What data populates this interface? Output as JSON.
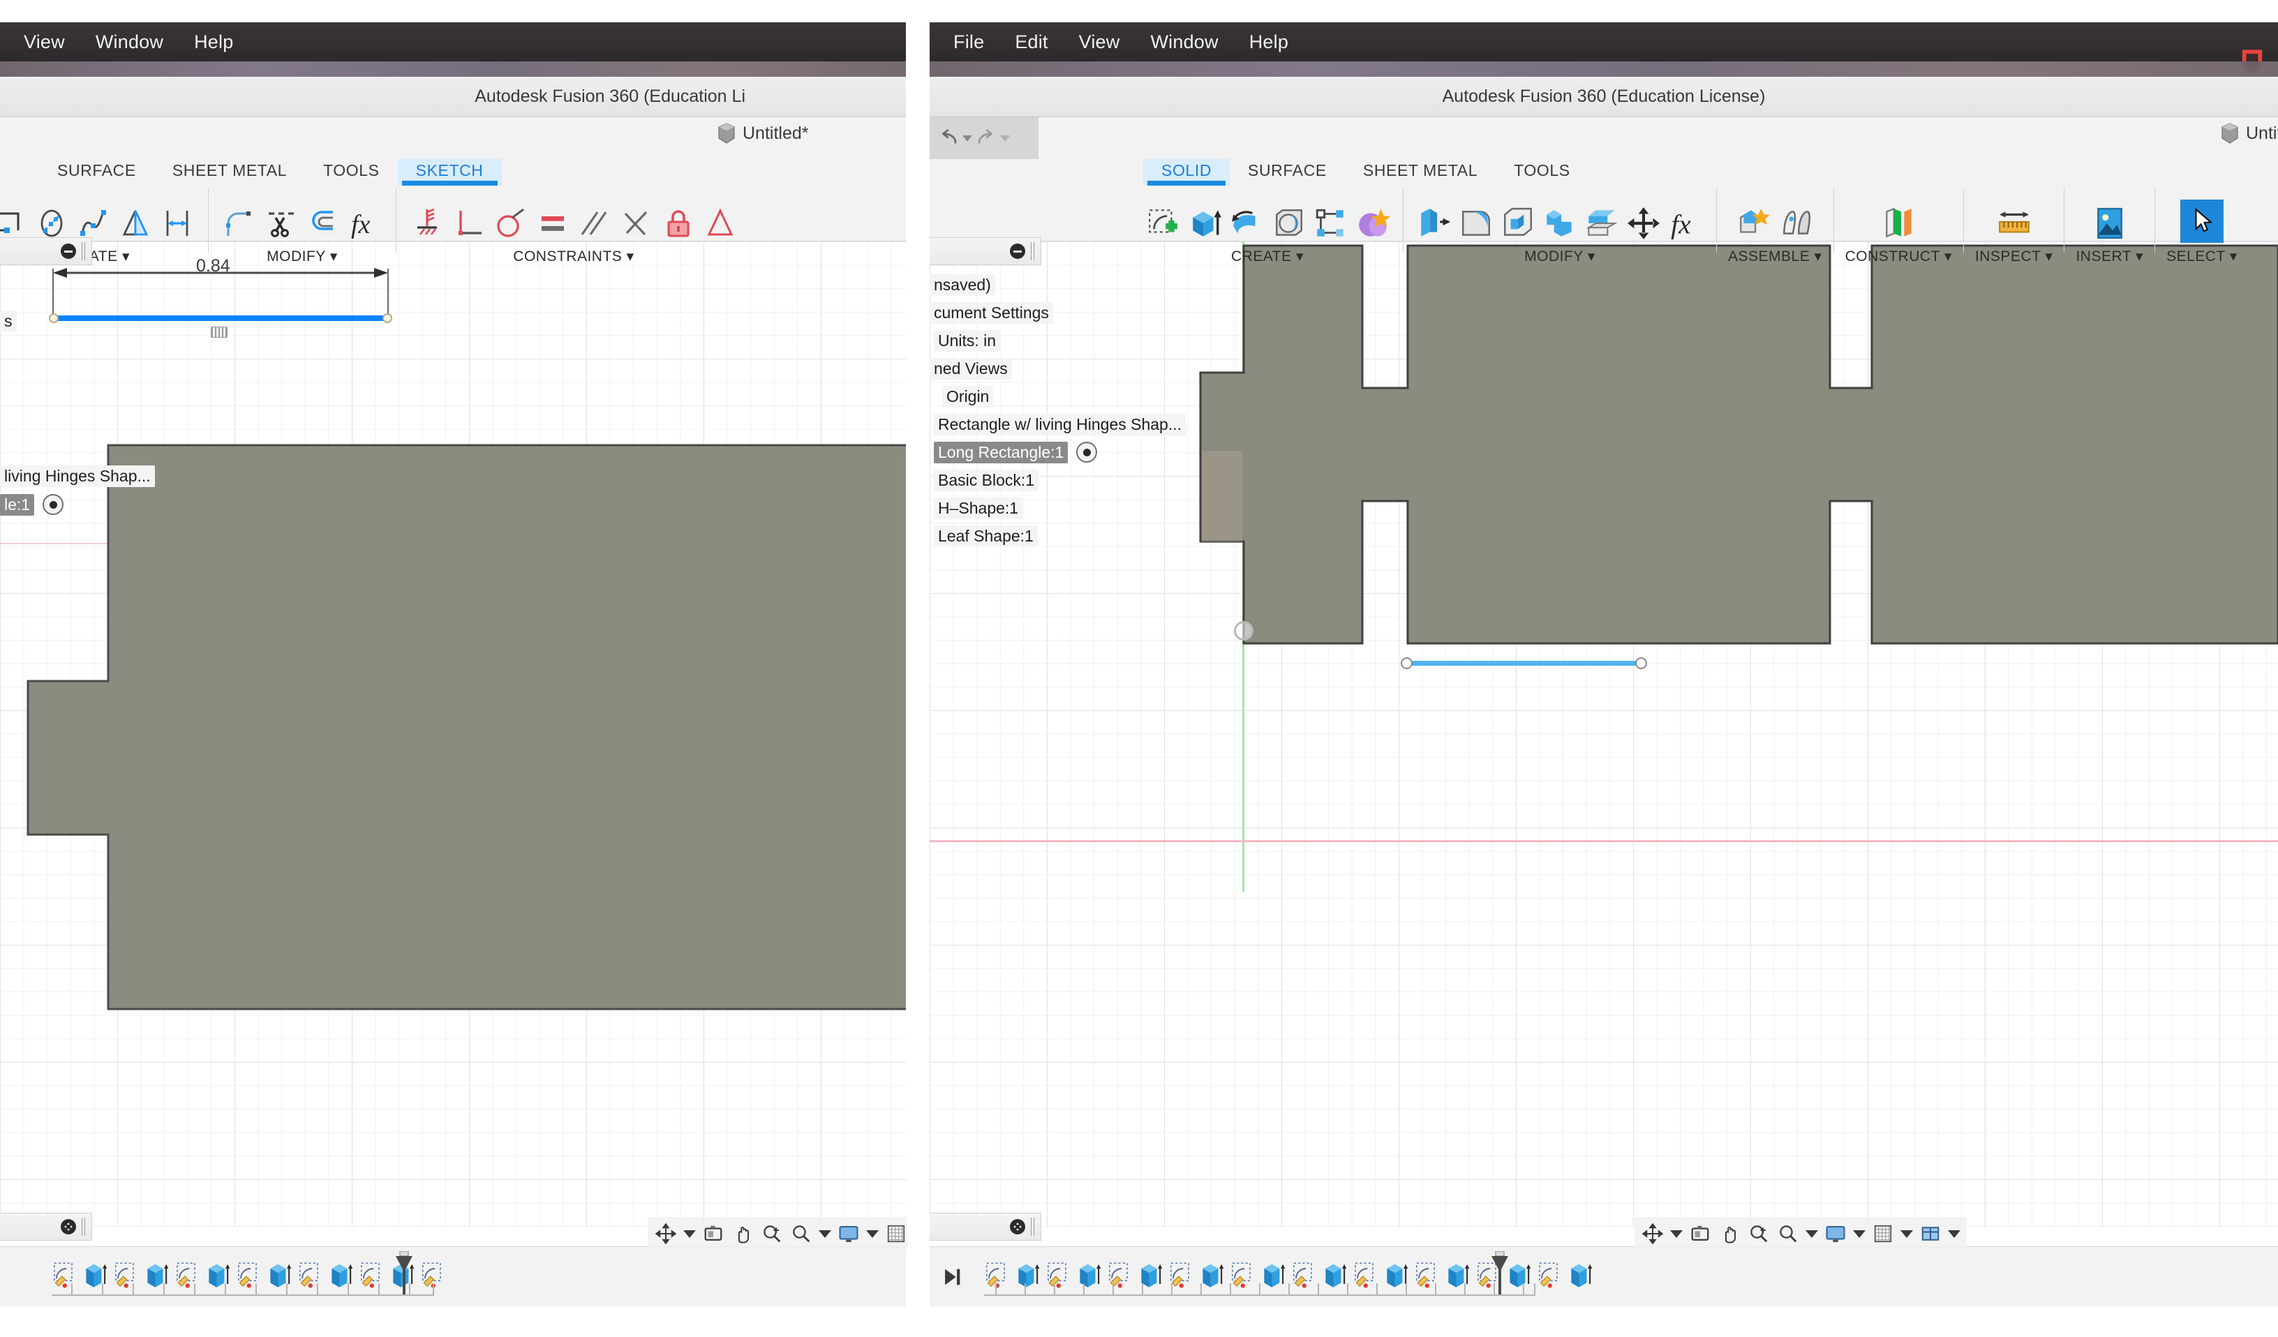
{
  "app": {
    "title": "Autodesk Fusion 360 (Education License)",
    "document_tab": "Untitled*",
    "accent_blue": "#1b8ae0",
    "selection_gray": "#8a8a8a",
    "body_fill": "#8b8b80"
  },
  "left_window": {
    "menubar": [
      "View",
      "Window",
      "Help"
    ],
    "title": "Autodesk Fusion 360 (Education Li",
    "document_tab": "Untitled*",
    "tabs": [
      {
        "label": "SURFACE",
        "active": false
      },
      {
        "label": "SHEET METAL",
        "active": false
      },
      {
        "label": "TOOLS",
        "active": false
      },
      {
        "label": "SKETCH",
        "active": true
      }
    ],
    "panels": [
      {
        "label": "CREATE",
        "icons": [
          "rectangle-icon",
          "ellipse-icon",
          "spline-icon",
          "mirror-icon",
          "sketch-dimension-icon"
        ]
      },
      {
        "label": "MODIFY",
        "icons": [
          "fillet-icon",
          "trim-icon",
          "offset-icon",
          "change-parameters-icon"
        ]
      },
      {
        "label": "CONSTRAINTS",
        "icons": [
          "fix-icon",
          "perpendicular-icon",
          "tangent-icon",
          "equal-icon",
          "parallel-icon",
          "midpoint-icon",
          "fix-unfix-lock-icon",
          "symmetry-icon"
        ]
      }
    ],
    "browser": {
      "items": [
        {
          "label": "s",
          "selected": false,
          "eye": false,
          "indent": 0
        },
        {
          "label": "living Hinges Shap...",
          "selected": false,
          "eye": false,
          "indent": 0
        },
        {
          "label": "le:1",
          "selected": true,
          "eye": true,
          "indent": 0
        }
      ]
    },
    "sketch": {
      "dimension_value": "0.84",
      "selected_line_color": "#0a84ff",
      "dimension_line_color": "#4a4a4a"
    },
    "nav_bar_icons": [
      "orbit-icon",
      "chevron-down-icon",
      "look-at-icon",
      "pan-icon",
      "zoom-window-icon",
      "zoom-icon",
      "chevron-down-icon",
      "display-settings-icon",
      "chevron-down-icon",
      "grid-snaps-icon",
      "chevron-down-icon"
    ],
    "timeline": {
      "item_count": 13,
      "marker": "timeline-end-marker"
    }
  },
  "right_window": {
    "menubar": [
      "File",
      "Edit",
      "View",
      "Window",
      "Help"
    ],
    "menubar_right_icon": "shield-icon",
    "title": "Autodesk Fusion 360 (Education License)",
    "document_tab": "Untitled*",
    "quick_access": [
      "undo-icon",
      "chevron-down-icon",
      "redo-icon",
      "chevron-down-icon"
    ],
    "tabs": [
      {
        "label": "SOLID",
        "active": true
      },
      {
        "label": "SURFACE",
        "active": false
      },
      {
        "label": "SHEET METAL",
        "active": false
      },
      {
        "label": "TOOLS",
        "active": false
      }
    ],
    "panels": [
      {
        "label": "CREATE",
        "icons": [
          "create-sketch-icon",
          "extrude-icon",
          "revolve-icon",
          "sweep-icon",
          "pattern-icon",
          "form-icon"
        ]
      },
      {
        "label": "MODIFY",
        "icons": [
          "press-pull-icon",
          "fillet-icon",
          "shell-icon",
          "combine-icon",
          "offset-face-icon",
          "move-copy-icon",
          "change-parameters-icon"
        ]
      },
      {
        "label": "ASSEMBLE",
        "icons": [
          "new-component-icon",
          "joint-icon"
        ]
      },
      {
        "label": "CONSTRUCT",
        "icons": [
          "offset-plane-icon"
        ]
      },
      {
        "label": "INSPECT",
        "icons": [
          "measure-icon"
        ]
      },
      {
        "label": "INSERT",
        "icons": [
          "insert-image-icon"
        ]
      },
      {
        "label": "SELECT",
        "icons": [
          "select-cursor-icon"
        ]
      }
    ],
    "browser": {
      "items": [
        {
          "label": "nsaved)",
          "selected": false,
          "eye": false,
          "indent": 0
        },
        {
          "label": "cument Settings",
          "selected": false,
          "eye": false,
          "indent": 0
        },
        {
          "label": "Units: in",
          "selected": false,
          "eye": false,
          "indent": 6
        },
        {
          "label": "ned Views",
          "selected": false,
          "eye": false,
          "indent": 0
        },
        {
          "label": "Origin",
          "selected": false,
          "eye": false,
          "indent": 18
        },
        {
          "label": "Rectangle w/ living Hinges Shap...",
          "selected": false,
          "eye": false,
          "indent": 6
        },
        {
          "label": "Long Rectangle:1",
          "selected": true,
          "eye": true,
          "indent": 6
        },
        {
          "label": "Basic Block:1",
          "selected": false,
          "eye": false,
          "indent": 6
        },
        {
          "label": "H–Shape:1",
          "selected": false,
          "eye": false,
          "indent": 6
        },
        {
          "label": "Leaf Shape:1",
          "selected": false,
          "eye": false,
          "indent": 6
        }
      ]
    },
    "sketch": {
      "selected_line_color": "#4fb4ee",
      "x_axis_color": "#f3b9c4",
      "y_axis_color": "#a6e3a6",
      "origin_point": "origin-point"
    },
    "nav_bar_icons": [
      "orbit-icon",
      "chevron-down-icon",
      "look-at-icon",
      "pan-icon",
      "zoom-window-icon",
      "zoom-icon",
      "chevron-down-icon",
      "display-settings-icon",
      "chevron-down-icon",
      "grid-snaps-icon",
      "chevron-down-icon",
      "viewports-icon",
      "chevron-down-icon"
    ],
    "timeline": {
      "item_count": 20,
      "play_button": "timeline-play-to-end",
      "marker": "timeline-end-marker"
    }
  }
}
